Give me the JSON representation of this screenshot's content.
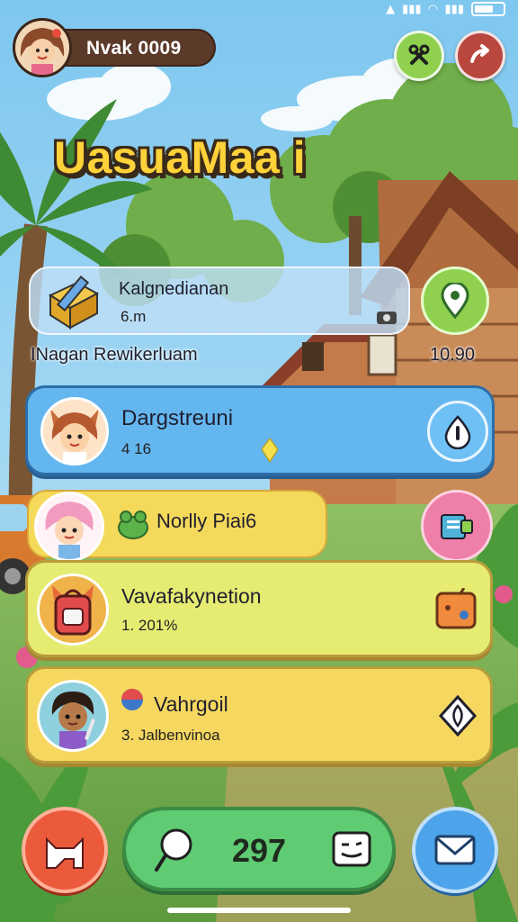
{
  "header": {
    "player_name": "Nvak 0009",
    "title": "UasuaMaa i"
  },
  "icons": {
    "profile": "girl-avatar-icon",
    "tools": "tools-icon",
    "exit": "exit-arrow-icon"
  },
  "cards": [
    {
      "id": "card-1",
      "label": "Kalgnedianan",
      "sub": "6.m",
      "icon": "box-pencil-icon",
      "side_icon": "location-pin-icon",
      "color": "#bedef6"
    },
    {
      "id": "card-2",
      "label": "Dargstreuni",
      "sub": "4 16",
      "icon": "fox-girl-avatar",
      "side_icon": "info-drop-icon",
      "color": "#64b6ef"
    },
    {
      "id": "card-3",
      "label": "Norlly Piai6",
      "icon": "pink-hair-avatar",
      "side_icon": "clipboard-icon",
      "color": "#f5d95a"
    },
    {
      "id": "card-4",
      "label": "Vavafakynetion",
      "sub": "1. 201%",
      "icon": "backpack-icon",
      "side_icon": "gamepad-box-icon",
      "color": "#e6ec72"
    },
    {
      "id": "card-5",
      "label": "Vahrgoil",
      "sub": "3. Jalbenvinoa",
      "icon": "boy-avatar",
      "side_icon": "leaf-badge-icon",
      "color": "#f6d860"
    }
  ],
  "overlay": {
    "left_text": "INagan Rewikerluam",
    "right_text": "10.90"
  },
  "bottom": {
    "count": "297",
    "left_icon": "cat-icon",
    "center_left_icon": "lollipop-icon",
    "center_right_icon": "face-box-icon",
    "right_icon": "mail-icon"
  }
}
